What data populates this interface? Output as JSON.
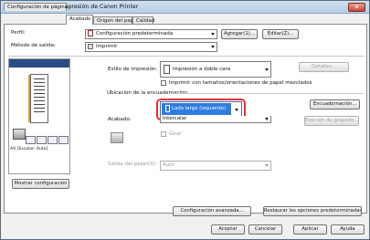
{
  "window": {
    "title": "Preferencias de impresión de Canon Printer"
  },
  "tabs": [
    {
      "label": "Configuración de página"
    },
    {
      "label": "Acabado"
    },
    {
      "label": "Origen del papel"
    },
    {
      "label": "Calidad"
    }
  ],
  "profile": {
    "label": "Perfil:",
    "value": "Configuración predeterminada",
    "add_button": "Agregar(1)...",
    "edit_button": "Editar(Z)..."
  },
  "output": {
    "label": "Método de salida:",
    "value": "Imprimir"
  },
  "print_style": {
    "label": "Estilo de impresión:",
    "value": "Impresión a doble cara",
    "details_button": "Detalles...",
    "mixed_checkbox": "Imprimir con tamaños/orientaciones de papel mezclados"
  },
  "binding": {
    "section_label": "Ubicación de la encuadernación:",
    "value": "Lado largo (izquierdo)",
    "gutter_button": "Encuadernación..."
  },
  "finishing": {
    "label": "Acabado:",
    "value": "Intercalar",
    "fold_button": "Posición de grapado...",
    "checkbox_label": "Girar"
  },
  "output_tray": {
    "label": "Salida del papel(X):",
    "value": "Auto"
  },
  "preview": {
    "caption": "A4 [Escalar: Auto]",
    "show_settings_button": "Mostrar configuración"
  },
  "bottom_buttons": {
    "advanced": "Configuración avanzada...",
    "restore": "Restaurar los opciones predeterminadas"
  },
  "dialog_buttons": {
    "ok": "Aceptar",
    "cancel": "Cancelar",
    "apply": "Aplicar",
    "help": "Ayuda"
  }
}
